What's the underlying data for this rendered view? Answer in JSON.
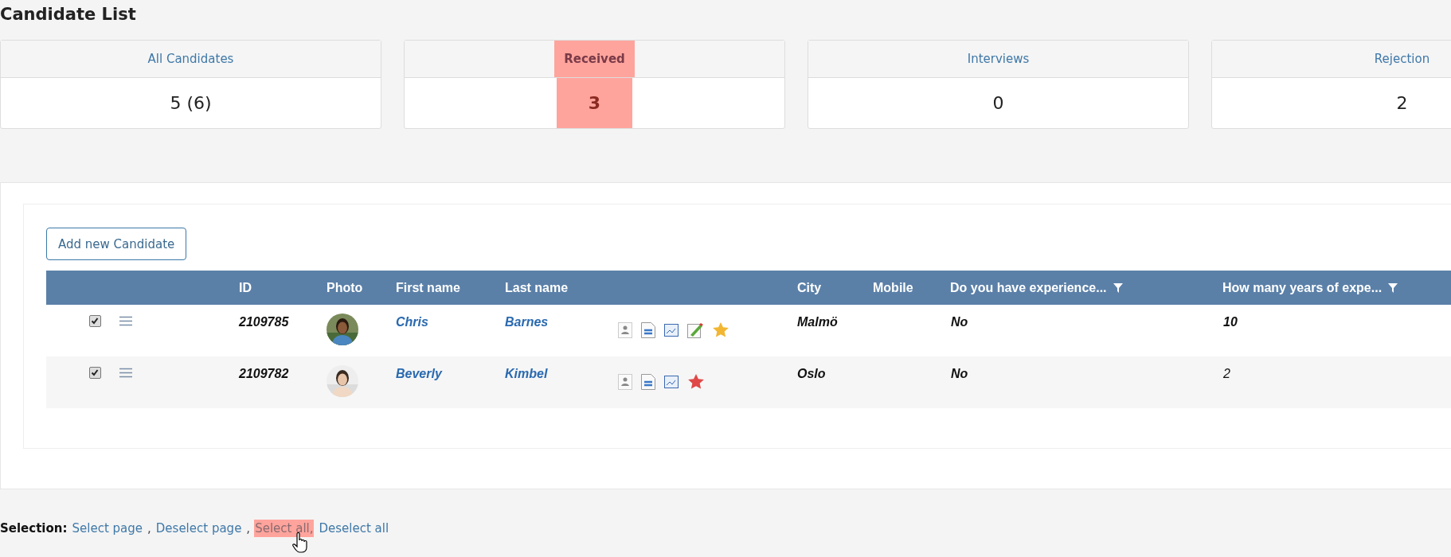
{
  "title": "Candidate List",
  "cards": [
    {
      "label": "All Candidates",
      "count": "5 (6)",
      "highlighted": false
    },
    {
      "label": "Received",
      "count": "3",
      "highlighted": true
    },
    {
      "label": "Interviews",
      "count": "0",
      "highlighted": false
    },
    {
      "label": "Rejection",
      "count": "2",
      "highlighted": false
    }
  ],
  "add_button": "Add new Candidate",
  "table": {
    "columns": [
      {
        "label": "ID",
        "filter": false
      },
      {
        "label": "Photo",
        "filter": false
      },
      {
        "label": "First name",
        "filter": false
      },
      {
        "label": "Last name",
        "filter": false
      },
      {
        "label": "City",
        "filter": false
      },
      {
        "label": "Mobile",
        "filter": false
      },
      {
        "label": "Do you have experience...",
        "filter": true
      },
      {
        "label": "How many years of expe...",
        "filter": true
      }
    ],
    "rows": [
      {
        "checked": true,
        "id": "2109785",
        "photo": {
          "kind": "picture"
        },
        "first_name": "Chris",
        "last_name": "Barnes",
        "icons": [
          {
            "kind": "profile"
          },
          {
            "kind": "cv"
          },
          {
            "kind": "document"
          },
          {
            "kind": "edit"
          },
          {
            "kind": "star",
            "color": "#f2b632"
          }
        ],
        "city": "Malmö",
        "experience": "No",
        "years": "10",
        "years_bold": true
      },
      {
        "checked": true,
        "id": "2109782",
        "photo": {
          "kind": "picture"
        },
        "first_name": "Beverly",
        "last_name": "Kimbel",
        "icons": [
          {
            "kind": "profile"
          },
          {
            "kind": "cv"
          },
          {
            "kind": "document"
          },
          {
            "kind": "star",
            "color": "#e04848"
          }
        ],
        "city": "Oslo",
        "experience": "No",
        "years": "2",
        "years_bold": false
      }
    ]
  },
  "selection": {
    "label": "Selection:",
    "links": [
      {
        "text": "Select page",
        "separator": ",",
        "highlighted": false
      },
      {
        "text": "Deselect page",
        "separator": ",",
        "highlighted": false
      },
      {
        "text": "Select all,",
        "highlighted": true
      },
      {
        "text": "Deselect all",
        "highlighted": false
      }
    ]
  }
}
